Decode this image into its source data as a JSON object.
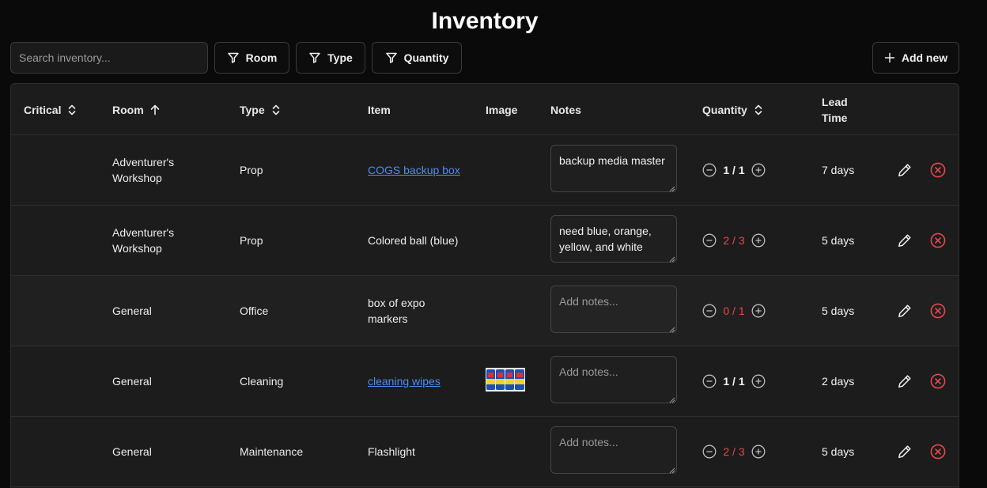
{
  "page": {
    "title": "Inventory"
  },
  "toolbar": {
    "search_placeholder": "Search inventory...",
    "filter_room": "Room",
    "filter_type": "Type",
    "filter_quantity": "Quantity",
    "add_new": "Add new"
  },
  "columns": {
    "critical": "Critical",
    "room": "Room",
    "type": "Type",
    "item": "Item",
    "image": "Image",
    "notes": "Notes",
    "quantity": "Quantity",
    "lead_time_1": "Lead",
    "lead_time_2": "Time"
  },
  "rows": [
    {
      "room": "Adventurer's Workshop",
      "type": "Prop",
      "item": "COGS backup box",
      "notes": "backup media master",
      "notes_placeholder": "Add notes...",
      "quantity": "1 / 1",
      "lead_time": "7 days"
    },
    {
      "room": "Adventurer's Workshop",
      "type": "Prop",
      "item": "Colored ball (blue)",
      "notes": "need blue, orange, yellow, and white",
      "notes_placeholder": "Add notes...",
      "quantity": "2 / 3",
      "lead_time": "5 days"
    },
    {
      "room": "General",
      "type": "Office",
      "item": "box of expo markers",
      "notes": "",
      "notes_placeholder": "Add notes...",
      "quantity": "0 / 1",
      "lead_time": "5 days"
    },
    {
      "room": "General",
      "type": "Cleaning",
      "item": "cleaning wipes",
      "notes": "",
      "notes_placeholder": "Add notes...",
      "quantity": "1 / 1",
      "lead_time": "2 days"
    },
    {
      "room": "General",
      "type": "Maintenance",
      "item": "Flashlight",
      "notes": "",
      "notes_placeholder": "Add notes...",
      "quantity": "2 / 3",
      "lead_time": "5 days"
    }
  ],
  "colors": {
    "background": "#0a0a0a",
    "table": "#1c1c1c",
    "link": "#4f8cf0",
    "danger": "#e5484d"
  },
  "icons": [
    "filter-icon",
    "plus-icon",
    "sort-icon",
    "sort-ascending-icon",
    "minus-circle-icon",
    "plus-circle-icon",
    "pencil-icon",
    "x-circle-icon"
  ]
}
